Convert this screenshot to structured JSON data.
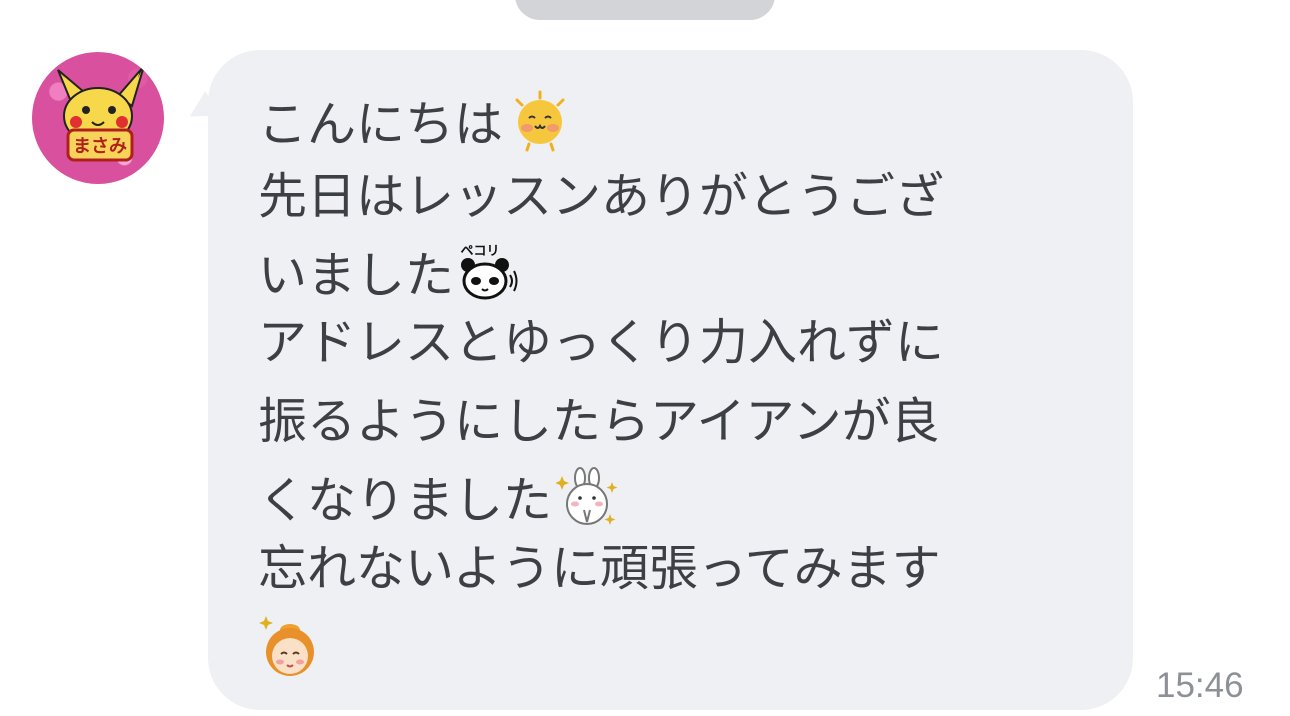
{
  "message": {
    "lines": [
      "こんにちは",
      "先日はレッスンありがとうござ",
      "いました",
      "アドレスとゆっくり力入れずに",
      "振るようにしたらアイアンが良",
      "くなりました",
      "忘れないように頑張ってみます"
    ],
    "timestamp": "15:46",
    "sticker_labels": {
      "panda": "ペコリ"
    }
  },
  "avatar": {
    "text": "まさみ"
  },
  "emojis": [
    "sun-face-emoji",
    "bowing-panda-emoji",
    "praying-rabbit-emoji",
    "sparkle-girl-emoji"
  ],
  "colors": {
    "bubble": "#eff0f3",
    "text": "#3c3f44",
    "time": "#8d9096",
    "avatar_bg": "#d8509e"
  }
}
